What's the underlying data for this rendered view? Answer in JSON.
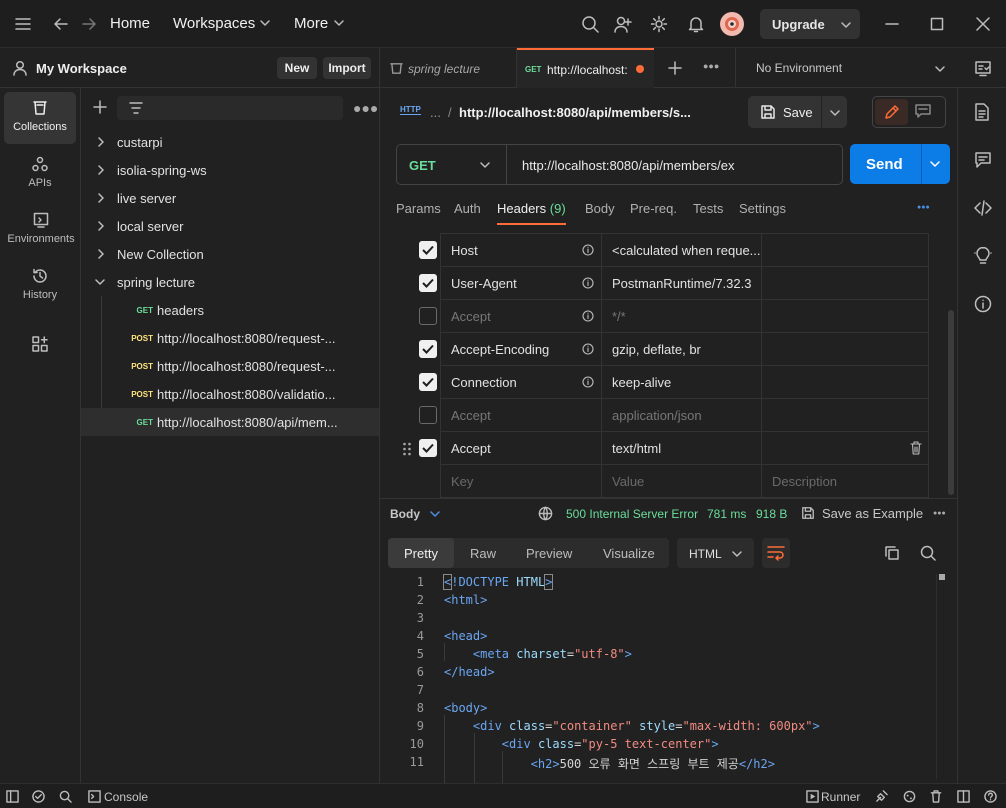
{
  "titlebar": {
    "home": "Home",
    "workspaces": "Workspaces",
    "more": "More",
    "upgrade": "Upgrade"
  },
  "workspace": {
    "name": "My Workspace",
    "new_label": "New",
    "import_label": "Import"
  },
  "rail": {
    "collections": "Collections",
    "apis": "APIs",
    "environments": "Environments",
    "history": "History"
  },
  "tree": {
    "folders": [
      "custarpi",
      "isolia-spring-ws",
      "live server",
      "local server",
      "New Collection",
      "spring lecture"
    ],
    "requests": [
      {
        "method": "GET",
        "name": "headers"
      },
      {
        "method": "POST",
        "name": "http://localhost:8080/request-..."
      },
      {
        "method": "POST",
        "name": "http://localhost:8080/request-..."
      },
      {
        "method": "POST",
        "name": "http://localhost:8080/validatio..."
      },
      {
        "method": "GET",
        "name": "http://localhost:8080/api/mem..."
      }
    ]
  },
  "tabs": {
    "tab1": "spring lecture",
    "tab2_method": "GET",
    "tab2_label": "http://localhost:",
    "environment": "No Environment"
  },
  "request": {
    "breadcrumb_ellipsis": "...",
    "breadcrumb_title": "http://localhost:8080/api/members/s...",
    "save_label": "Save",
    "method": "GET",
    "url": "http://localhost:8080/api/members/ex",
    "send_label": "Send",
    "subtabs": {
      "params": "Params",
      "auth": "Auth",
      "headers": "Headers",
      "headers_count": "(9)",
      "body": "Body",
      "prereq": "Pre-req.",
      "tests": "Tests",
      "settings": "Settings"
    },
    "headers": [
      {
        "key": "Host",
        "value": "<calculated when reque...",
        "checked": true,
        "info": true
      },
      {
        "key": "User-Agent",
        "value": "PostmanRuntime/7.32.3",
        "checked": true,
        "info": true
      },
      {
        "key": "Accept",
        "value": "*/*",
        "checked": false,
        "info": true
      },
      {
        "key": "Accept-Encoding",
        "value": "gzip, deflate, br",
        "checked": true,
        "info": true
      },
      {
        "key": "Connection",
        "value": "keep-alive",
        "checked": true,
        "info": true
      },
      {
        "key": "Accept",
        "value": "application/json",
        "checked": false,
        "info": false
      },
      {
        "key": "Accept",
        "value": "text/html",
        "checked": true,
        "info": false
      }
    ],
    "placeholder": {
      "key": "Key",
      "value": "Value",
      "desc": "Description"
    }
  },
  "response": {
    "body_label": "Body",
    "status": "500 Internal Server Error",
    "time": "781 ms",
    "size": "918 B",
    "save_example": "Save as Example",
    "views": [
      "Pretty",
      "Raw",
      "Preview",
      "Visualize"
    ],
    "format": "HTML",
    "lines": [
      "1",
      "2",
      "3",
      "4",
      "5",
      "6",
      "7",
      "8",
      "9",
      "10",
      "11"
    ]
  },
  "statusbar": {
    "console": "Console",
    "runner": "Runner"
  }
}
